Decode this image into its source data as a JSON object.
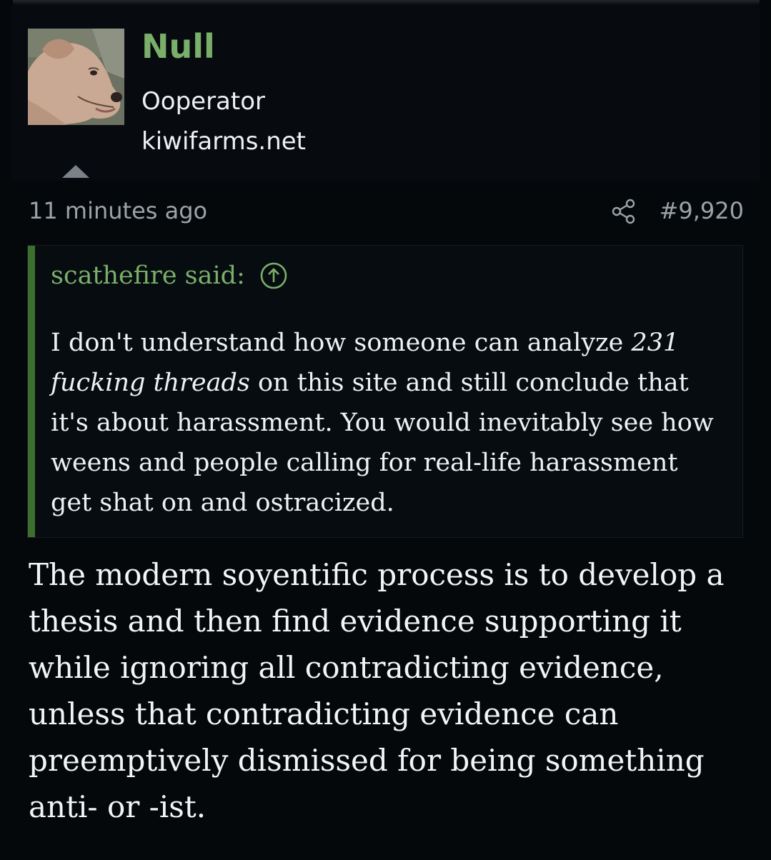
{
  "user": {
    "avatar_name": "dog-avatar",
    "name": "Null",
    "title": "Ooperator",
    "banner": "kiwifarms.net"
  },
  "post": {
    "timestamp": "11 minutes ago",
    "share_icon": "share-icon",
    "number": "#9,920"
  },
  "quote": {
    "author": "scathefire said:",
    "jump_icon": "arrow-up-circle-icon",
    "text_before": "I don't understand how someone can analyze ",
    "text_emphasis": "231 fucking threads",
    "text_after": " on this site and still conclude that it's about harassment. You would inevitably see how weens and people calling for real-life harassment get shat on and ostracized."
  },
  "body": {
    "text": "The modern soyentific process is to develop a thesis and then find evidence supporting it while ignoring all contradicting evidence, unless that contradicting evidence can preemptively dismissed for being something anti- or -ist."
  },
  "colors": {
    "background": "#05080b",
    "accent_green": "#7aaf6a",
    "quote_bar": "#3c6e2e",
    "muted_text": "#9ba3aa"
  }
}
